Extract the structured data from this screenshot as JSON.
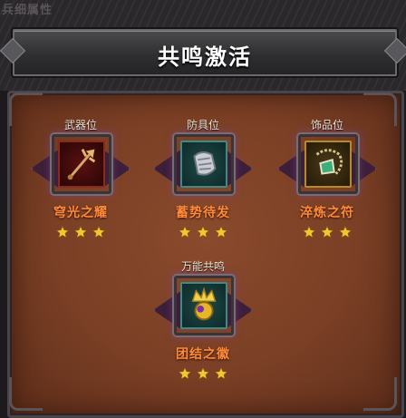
{
  "top_tab": "兵细属性",
  "title": "共鸣激活",
  "slots": [
    {
      "label": "武器位",
      "name": "穹光之耀",
      "stars": 3,
      "icon": "trident-icon"
    },
    {
      "label": "防具位",
      "name": "蓄势待发",
      "stars": 3,
      "icon": "gauntlet-icon"
    },
    {
      "label": "饰品位",
      "name": "淬炼之符",
      "stars": 3,
      "icon": "amulet-icon"
    },
    {
      "label": "万能共鸣",
      "name": "团结之徽",
      "stars": 3,
      "icon": "crown-orb-icon"
    }
  ],
  "colors": {
    "accent_name": "#ff8a3a",
    "star": "#f5c531",
    "panel": "#7a3f25"
  }
}
